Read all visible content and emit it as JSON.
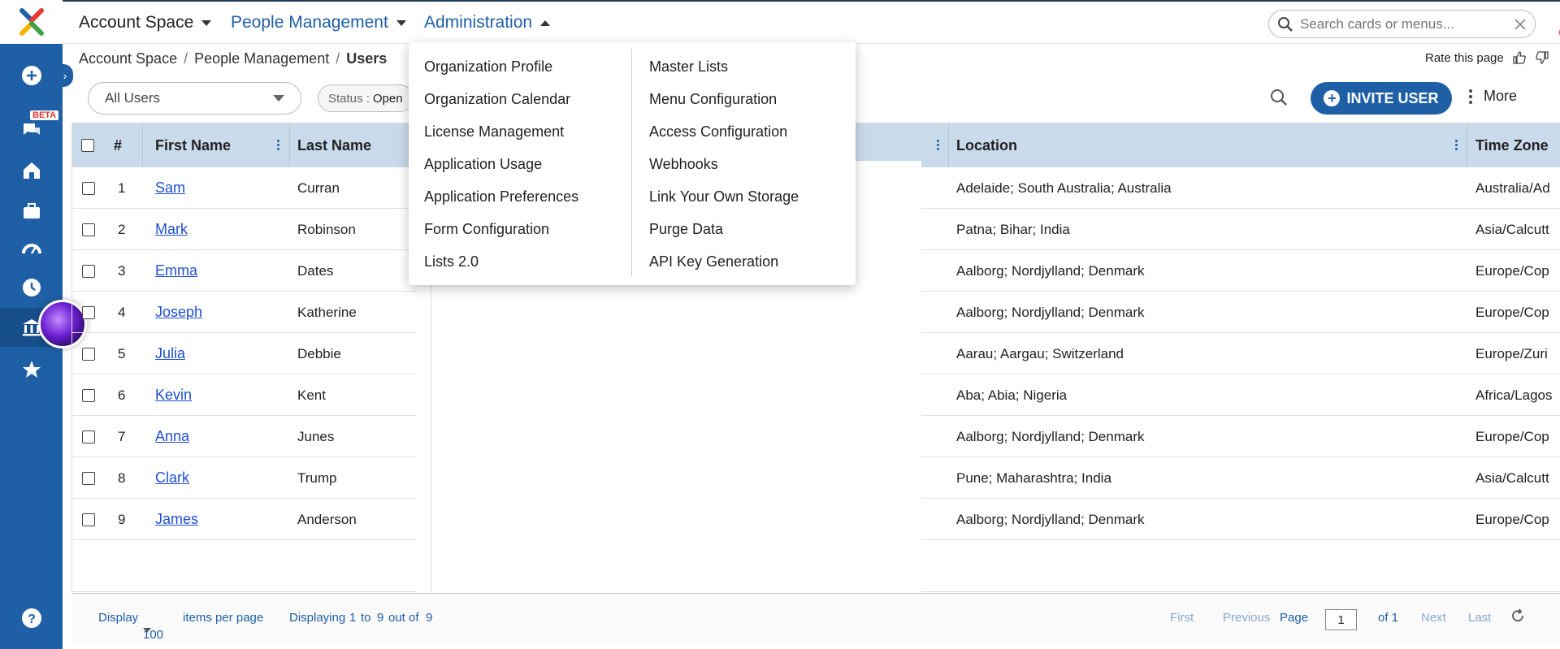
{
  "topnav": {
    "account_space": "Account Space",
    "people_management": "People Management",
    "administration": "Administration"
  },
  "search": {
    "placeholder": "Search cards or menus..."
  },
  "breadcrumb": [
    "Account Space",
    "People Management",
    "Users"
  ],
  "rate_label": "Rate this page",
  "rail": {
    "beta": "BETA"
  },
  "toolbar": {
    "filter_value": "All Users",
    "status_label": "Status :",
    "status_value": "Open",
    "invite_label": "INVITE USER",
    "more_label": "More"
  },
  "table": {
    "columns": [
      "#",
      "First Name",
      "Last Name",
      "Location",
      "Time Zone"
    ],
    "rows": [
      {
        "n": "1",
        "first": "Sam",
        "last": "Curran",
        "location": "Adelaide; South Australia; Australia",
        "tz": "Australia/Ad"
      },
      {
        "n": "2",
        "first": "Mark",
        "last": "Robinson",
        "location": "Patna; Bihar; India",
        "tz": "Asia/Calcutt"
      },
      {
        "n": "3",
        "first": "Emma",
        "last": "Dates",
        "location": "Aalborg; Nordjylland; Denmark",
        "tz": "Europe/Cop"
      },
      {
        "n": "4",
        "first": "Joseph",
        "last": "Katherine",
        "location": "Aalborg; Nordjylland; Denmark",
        "tz": "Europe/Cop"
      },
      {
        "n": "5",
        "first": "Julia",
        "last": "Debbie",
        "location": "Aarau; Aargau; Switzerland",
        "tz": "Europe/Zuri"
      },
      {
        "n": "6",
        "first": "Kevin",
        "last": "Kent",
        "location": "Aba; Abia; Nigeria",
        "tz": "Africa/Lagos"
      },
      {
        "n": "7",
        "first": "Anna",
        "last": "Junes",
        "location": "Aalborg; Nordjylland; Denmark",
        "tz": "Europe/Cop"
      },
      {
        "n": "8",
        "first": "Clark",
        "last": "Trump",
        "location": "Pune; Maharashtra; India",
        "tz": "Asia/Calcutt"
      },
      {
        "n": "9",
        "first": "James",
        "last": "Anderson",
        "location": "Aalborg; Nordjylland; Denmark",
        "tz": "Europe/Cop"
      }
    ]
  },
  "footer": {
    "display": "Display",
    "per_page": "100",
    "items_per_page": "items per page",
    "displaying": "Displaying",
    "from": "1",
    "to_word": "to",
    "to": "9",
    "out_of": "out of",
    "total": "9",
    "first": "First",
    "previous": "Previous",
    "page": "Page",
    "page_value": "1",
    "of": "of 1",
    "next": "Next",
    "last": "Last"
  },
  "admin_menu": {
    "left": [
      "Organization Profile",
      "Organization Calendar",
      "License Management",
      "Application Usage",
      "Application Preferences",
      "Form Configuration",
      "Lists 2.0"
    ],
    "right": [
      "Master Lists",
      "Menu Configuration",
      "Access Configuration",
      "Webhooks",
      "Link Your Own Storage",
      "Purge Data",
      "API Key Generation"
    ]
  },
  "colors": {
    "brand": "#1f5fa6",
    "header_bg": "#c9daea",
    "link": "#1f4fd1"
  }
}
